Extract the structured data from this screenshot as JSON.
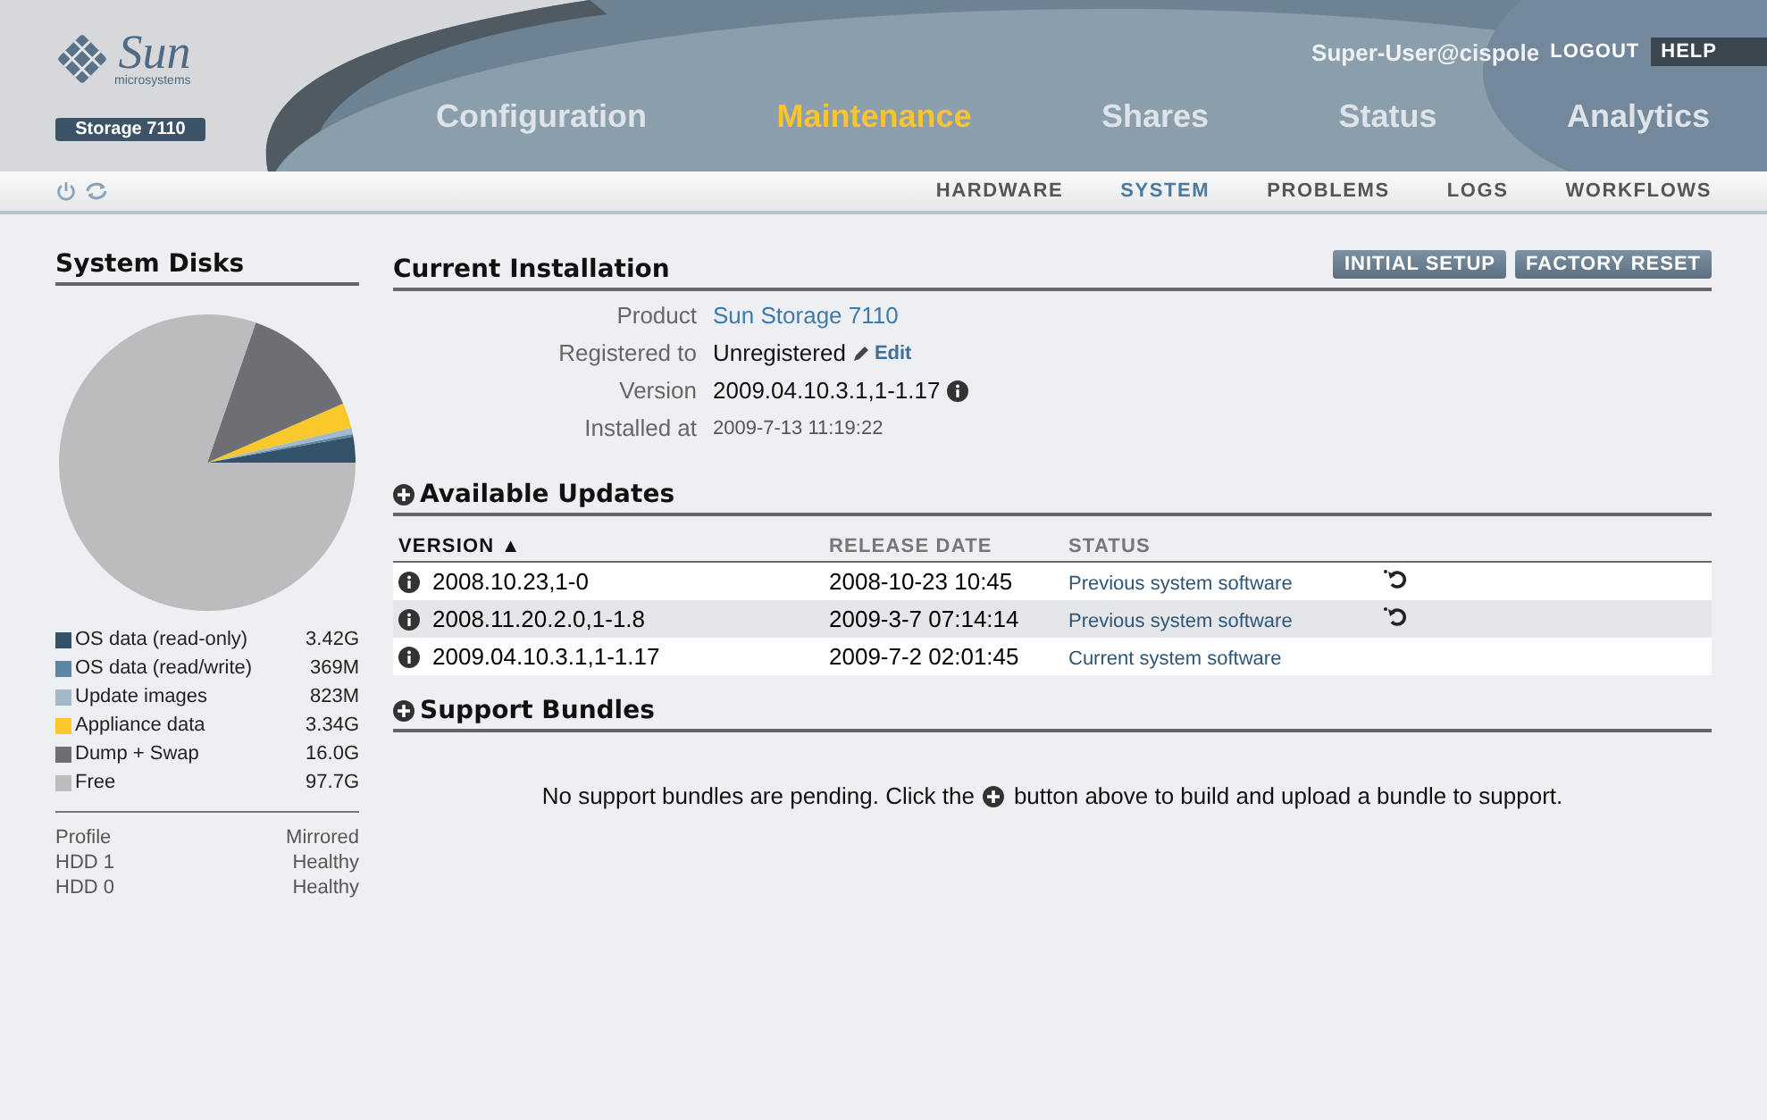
{
  "brand": {
    "logo": "Sun",
    "logo_sub": "microsystems",
    "model": "Storage 7110"
  },
  "user": {
    "name": "Super-User@cispole",
    "logout": "LOGOUT",
    "help": "HELP"
  },
  "nav": [
    {
      "label": "Configuration",
      "selected": false
    },
    {
      "label": "Maintenance",
      "selected": true
    },
    {
      "label": "Shares",
      "selected": false
    },
    {
      "label": "Status",
      "selected": false
    },
    {
      "label": "Analytics",
      "selected": false
    }
  ],
  "subnav": [
    {
      "label": "HARDWARE",
      "selected": false
    },
    {
      "label": "SYSTEM",
      "selected": true
    },
    {
      "label": "PROBLEMS",
      "selected": false
    },
    {
      "label": "LOGS",
      "selected": false
    },
    {
      "label": "WORKFLOWS",
      "selected": false
    }
  ],
  "sidebar": {
    "chart_data": {
      "type": "pie",
      "categories": [
        "OS data (read-only)",
        "OS data (read/write)",
        "Update images",
        "Appliance data",
        "Dump + Swap",
        "Free"
      ],
      "series": [
        {
          "name": "System Disks",
          "values": [
            2.81,
            0.3,
            0.68,
            2.75,
            13.15,
            80.31
          ]
        }
      ]
    },
    "legend": [
      {
        "value": "3.42G",
        "color": "#34536a"
      },
      {
        "value": "369M",
        "color": "#5a86a4"
      },
      {
        "value": "823M",
        "color": "#a3b8c9"
      },
      {
        "value": "3.34G",
        "color": "#fac82a"
      },
      {
        "value": "16.0G",
        "color": "#6e6f74"
      },
      {
        "value": "97.7G",
        "color": "#bcbcbe"
      }
    ],
    "disks": [
      {
        "label": "Profile",
        "value": "Mirrored"
      },
      {
        "label": "HDD 1",
        "value": "Healthy"
      },
      {
        "label": "HDD 0",
        "value": "Healthy"
      }
    ]
  },
  "installation": {
    "title": "Current Installation",
    "buttons": [
      "INITIAL SETUP",
      "FACTORY RESET"
    ],
    "product_label": "Product",
    "product": "Sun Storage 7110",
    "registered_label": "Registered to",
    "registered": "Unregistered",
    "edit": "Edit",
    "version_label": "Version",
    "version": "2009.04.10.3.1,1-1.17",
    "installed_label": "Installed at",
    "installed": "2009-7-13 11:19:22"
  },
  "updates": {
    "title": "Available Updates",
    "columns": [
      "VERSION ▲",
      "RELEASE DATE",
      "STATUS"
    ],
    "rows": [
      {
        "version": "2008.10.23,1-0",
        "date": "2008-10-23 10:45",
        "status": "Previous system software",
        "rollback": true
      },
      {
        "version": "2008.11.20.2.0,1-1.8",
        "date": "2009-3-7 07:14:14",
        "status": "Previous system software",
        "rollback": true
      },
      {
        "version": "2009.04.10.3.1,1-1.17",
        "date": "2009-7-2 02:01:45",
        "status": "Current system software",
        "rollback": false
      }
    ]
  },
  "bundles": {
    "title": "Support Bundles",
    "message_before": "No support bundles are pending. Click the",
    "message_after": "button above to build and upload a bundle to support."
  }
}
